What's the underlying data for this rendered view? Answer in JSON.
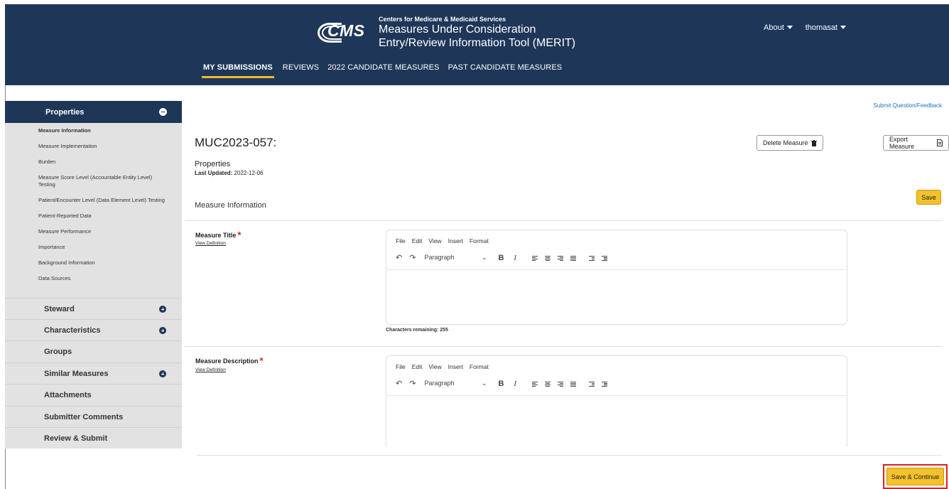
{
  "header": {
    "logo_text": "CMS",
    "org": "Centers for Medicare & Medicaid Services",
    "title_line1": "Measures Under Consideration",
    "title_line2": "Entry/Review Information Tool (MERIT)",
    "about_label": "About",
    "user_label": "thomasat"
  },
  "nav": {
    "tabs": [
      {
        "label": "MY SUBMISSIONS",
        "active": true
      },
      {
        "label": "REVIEWS"
      },
      {
        "label": "2022 CANDIDATE MEASURES"
      },
      {
        "label": "PAST CANDIDATE MEASURES"
      }
    ]
  },
  "sidebar": {
    "properties_label": "Properties",
    "sub_items": [
      {
        "label": "Measure Information",
        "active": true
      },
      {
        "label": "Measure Implementation"
      },
      {
        "label": "Burden"
      },
      {
        "label": "Measure Score Level (Accountable Entity Level) Testing"
      },
      {
        "label": "Patient/Encounter Level (Data Element Level) Testing"
      },
      {
        "label": "Patient-Reported Data"
      },
      {
        "label": "Measure Performance"
      },
      {
        "label": "Importance"
      },
      {
        "label": "Background Information"
      },
      {
        "label": "Data Sources"
      }
    ],
    "sections": [
      {
        "label": "Steward",
        "expandable": true
      },
      {
        "label": "Characteristics",
        "expandable": true
      },
      {
        "label": "Groups",
        "expandable": false
      },
      {
        "label": "Similar Measures",
        "expandable": true
      },
      {
        "label": "Attachments",
        "expandable": false
      },
      {
        "label": "Submitter Comments",
        "expandable": false
      },
      {
        "label": "Review & Submit",
        "expandable": false
      }
    ]
  },
  "main": {
    "feedback_link": "Submit Question/Feedback",
    "measure_id": "MUC2023-057:",
    "delete_label": "Delete Measure",
    "export_label": "Export Measure",
    "section_label": "Properties",
    "last_updated_label": "Last Updated:",
    "last_updated_value": "2022-12-06",
    "save_label": "Save",
    "subsection_title": "Measure Information",
    "fields": [
      {
        "label": "Measure Title",
        "view_def": "View Definition",
        "chars_remaining": "Characters remaining: 255"
      },
      {
        "label": "Measure Description",
        "view_def": "View Definition"
      }
    ],
    "editor": {
      "menu": [
        "File",
        "Edit",
        "View",
        "Insert",
        "Format"
      ],
      "block_format": "Paragraph"
    },
    "save_continue_label": "Save & Continue"
  }
}
